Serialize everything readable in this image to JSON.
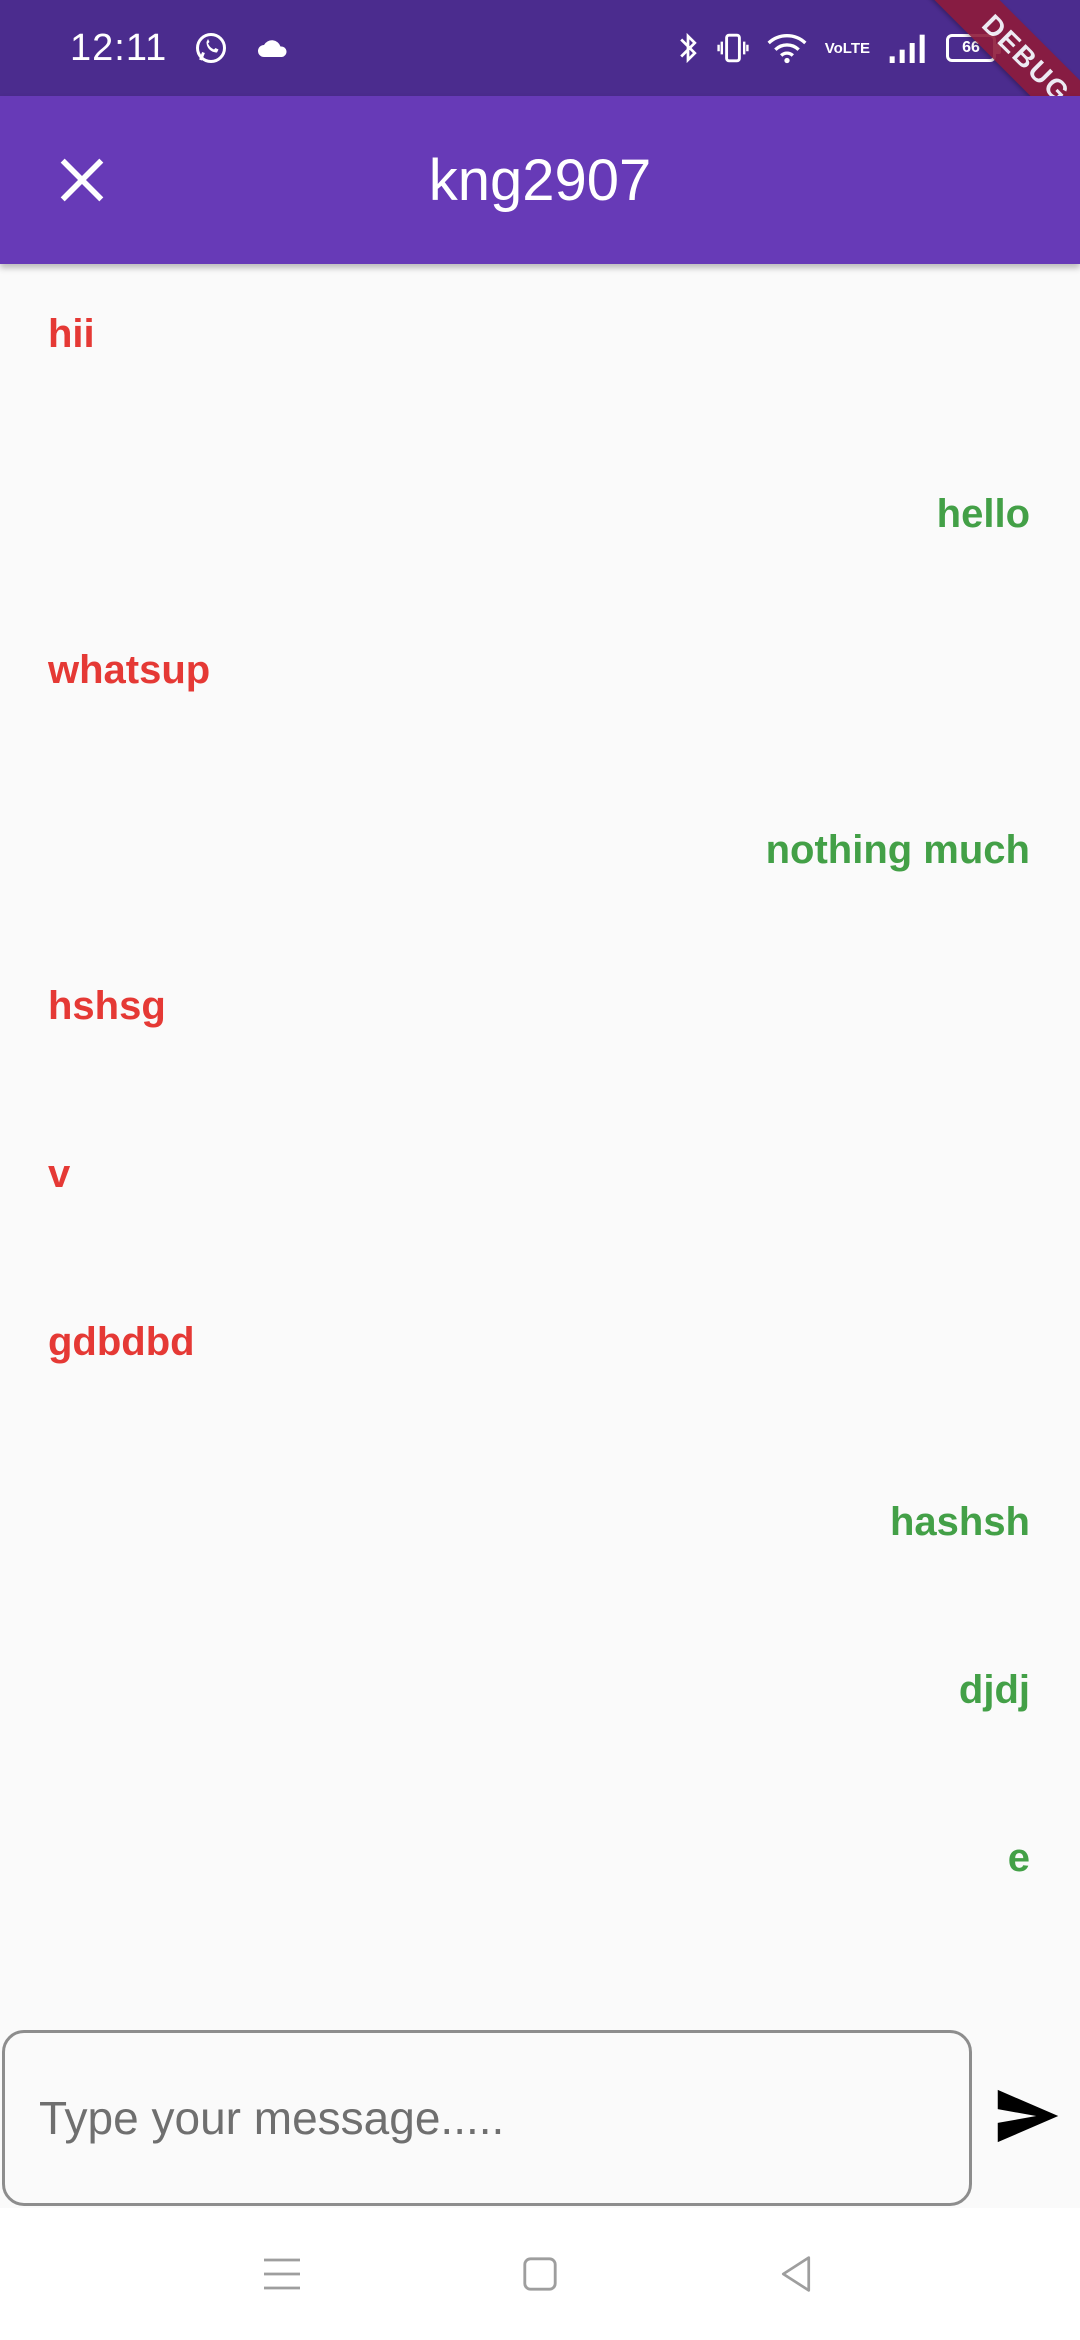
{
  "status_bar": {
    "time": "12:11",
    "icons": [
      "whatsapp-icon",
      "cloud-icon",
      "bluetooth-icon",
      "vibrate-icon",
      "wifi-icon",
      "volte-icon",
      "signal-icon",
      "battery-icon"
    ],
    "volte_top": "Vo",
    "volte_bottom": "LTE",
    "battery_level": "66"
  },
  "debug_banner": "DEBUG",
  "app_bar": {
    "title": "kng2907",
    "color": "#673ab7"
  },
  "messages": [
    {
      "text": "hii",
      "side": "left"
    },
    {
      "text": "hello",
      "side": "right"
    },
    {
      "text": "whatsup",
      "side": "left"
    },
    {
      "text": "nothing much",
      "side": "right"
    },
    {
      "text": "hshsg",
      "side": "left"
    },
    {
      "text": "v",
      "side": "left"
    },
    {
      "text": "gdbdbd",
      "side": "left"
    },
    {
      "text": "hashsh",
      "side": "right"
    },
    {
      "text": "djdj",
      "side": "right"
    },
    {
      "text": "e",
      "side": "right"
    }
  ],
  "colors": {
    "received": "#e53935",
    "sent": "#43a047"
  },
  "composer": {
    "placeholder": "Type your message.....",
    "value": ""
  },
  "nav_bar": {
    "buttons": [
      "menu-icon",
      "home-icon",
      "back-icon"
    ]
  }
}
